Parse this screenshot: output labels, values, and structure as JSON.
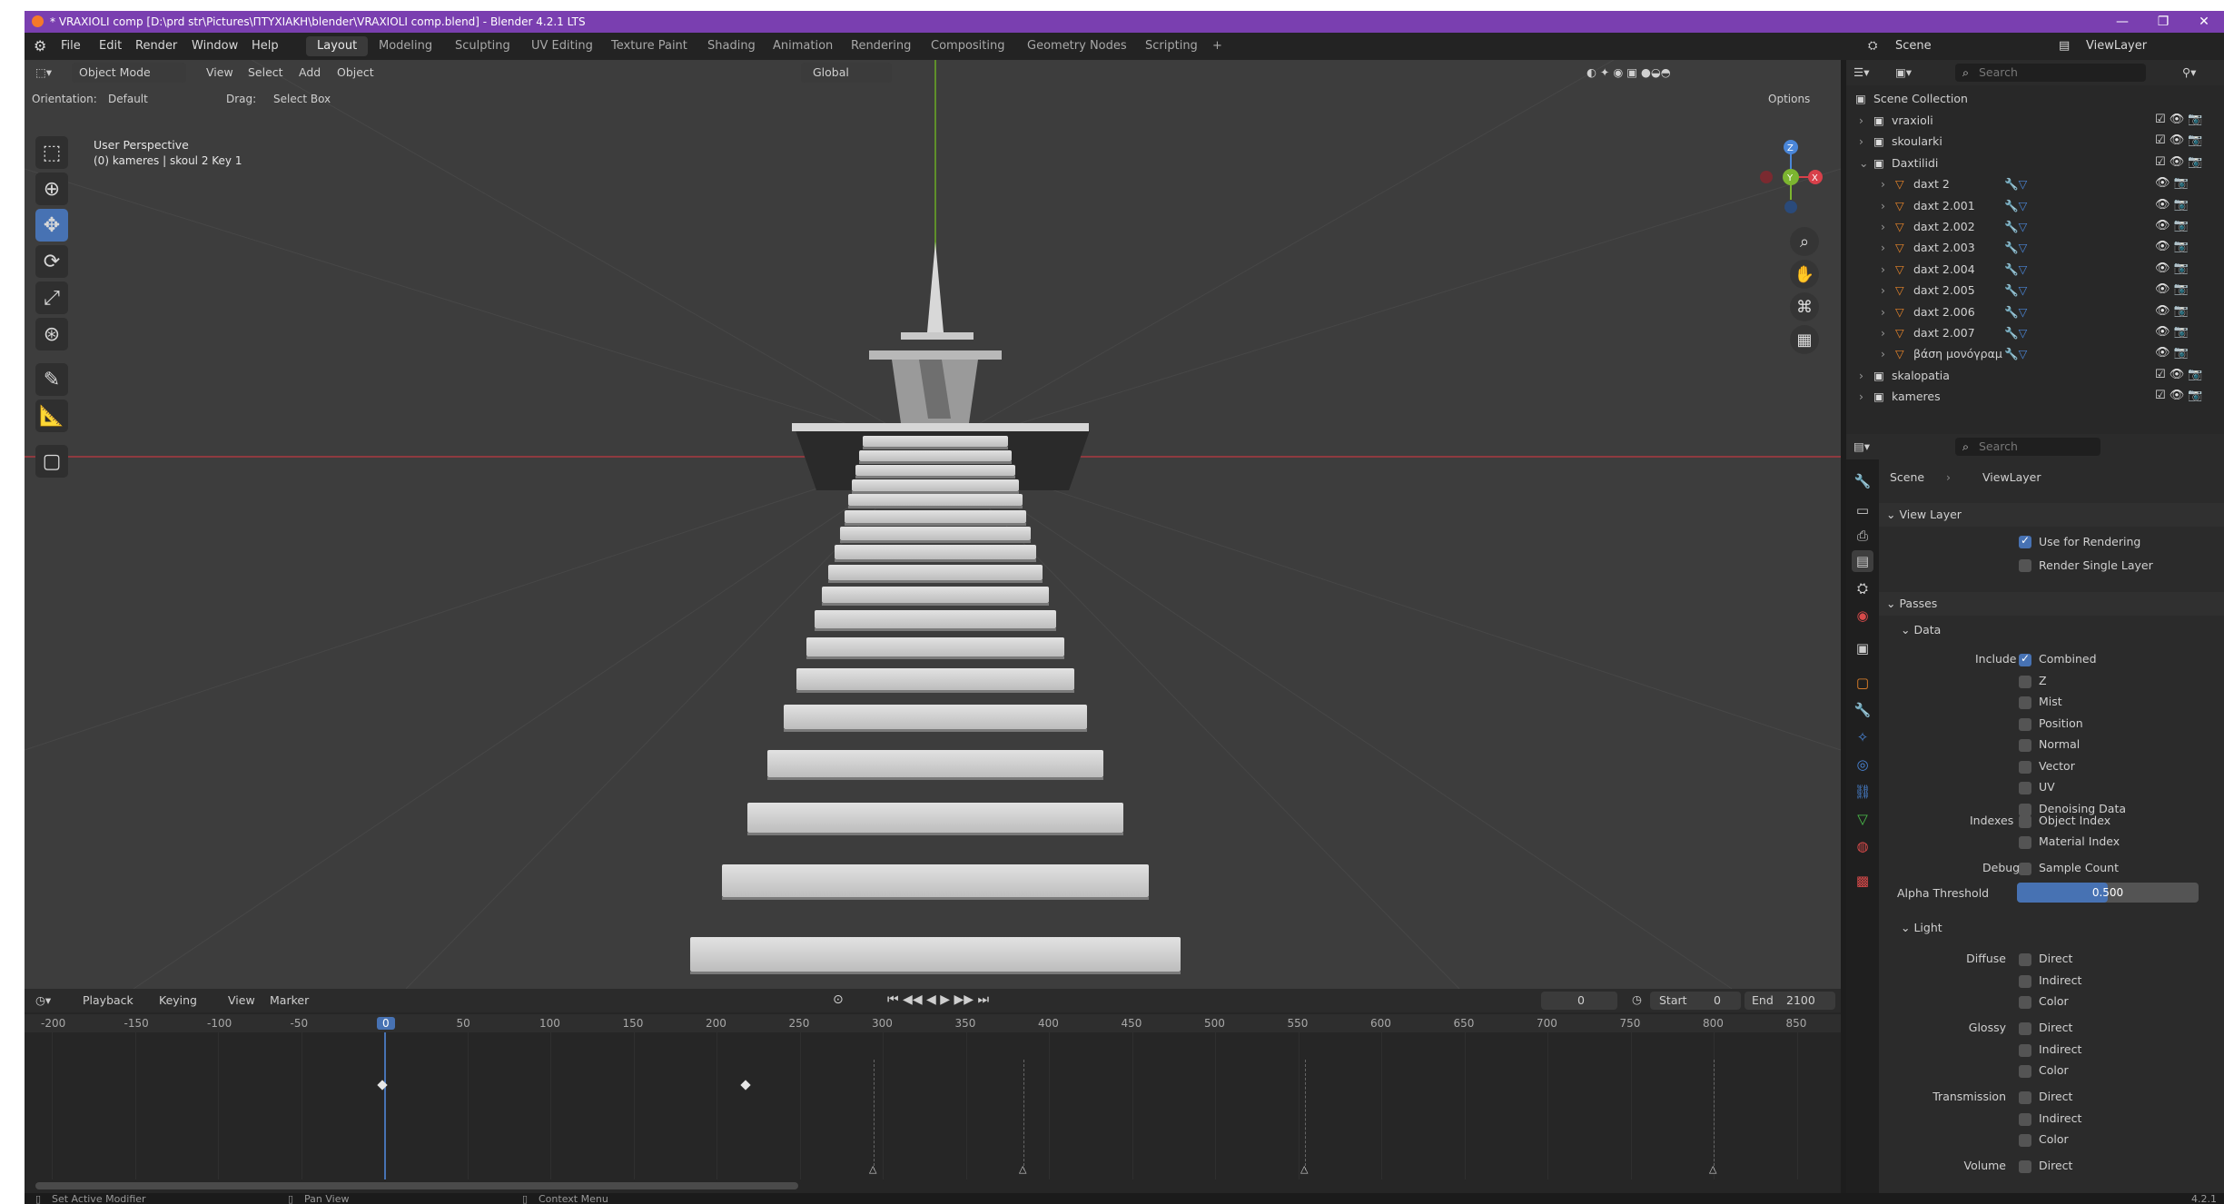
{
  "titlebar": {
    "title": "* VRAXIOLI comp [D:\\prd str\\Pictures\\ΠΤΥΧΙΑΚΗ\\blender\\VRAXIOLI comp.blend] - Blender 4.2.1 LTS",
    "minimize": "—",
    "maximize": "❐",
    "close": "✕"
  },
  "menubar": {
    "items": [
      "File",
      "Edit",
      "Render",
      "Window",
      "Help"
    ],
    "workspaces": [
      "Layout",
      "Modeling",
      "Sculpting",
      "UV Editing",
      "Texture Paint",
      "Shading",
      "Animation",
      "Rendering",
      "Compositing",
      "Geometry Nodes",
      "Scripting"
    ],
    "add_workspace": "+",
    "scene_label": "Scene",
    "viewlayer_label": "ViewLayer"
  },
  "viewport_header": {
    "mode": "Object Mode",
    "menus": [
      "View",
      "Select",
      "Add",
      "Object"
    ],
    "transform": "Global",
    "orientation_label": "Orientation:",
    "orientation_value": "Default",
    "drag_label": "Drag:",
    "drag_value": "Select Box",
    "options": "Options"
  },
  "viewport": {
    "perspective": "User Perspective",
    "info": "(0) kameres | skoul 2  Key 1",
    "nav_axes": [
      "Z",
      "Y",
      "X"
    ]
  },
  "timeline": {
    "menus": [
      "Playback",
      "Keying",
      "View",
      "Marker"
    ],
    "current_frame": "0",
    "start_label": "Start",
    "start_value": "0",
    "end_label": "End",
    "end_value": "2100",
    "ticks": [
      "-200",
      "-150",
      "-100",
      "-50",
      "0",
      "50",
      "100",
      "150",
      "200",
      "250",
      "300",
      "350",
      "400",
      "450",
      "500",
      "550",
      "600",
      "650",
      "700",
      "750",
      "800",
      "850"
    ]
  },
  "statusbar": {
    "items": [
      "Set Active Modifier",
      "Pan View",
      "Context Menu"
    ],
    "version": "4.2.1"
  },
  "outliner": {
    "search_placeholder": "Search",
    "root": "Scene Collection",
    "rows": [
      {
        "name": "vraxioli",
        "indent": 0
      },
      {
        "name": "skoularki",
        "indent": 0
      },
      {
        "name": "Daxtilidi",
        "indent": 0
      },
      {
        "name": "daxt 2",
        "indent": 1
      },
      {
        "name": "daxt 2.001",
        "indent": 1
      },
      {
        "name": "daxt 2.002",
        "indent": 1
      },
      {
        "name": "daxt 2.003",
        "indent": 1
      },
      {
        "name": "daxt 2.004",
        "indent": 1
      },
      {
        "name": "daxt 2.005",
        "indent": 1
      },
      {
        "name": "daxt 2.006",
        "indent": 1
      },
      {
        "name": "daxt 2.007",
        "indent": 1
      },
      {
        "name": "βάση μονόγραμ",
        "indent": 1
      },
      {
        "name": "skalopatia",
        "indent": 0
      },
      {
        "name": "kameres",
        "indent": 0
      }
    ]
  },
  "properties": {
    "search_placeholder": "Search",
    "breadcrumb_scene": "Scene",
    "breadcrumb_layer": "ViewLayer",
    "view_layer_section": "View Layer",
    "use_for_rendering": "Use for Rendering",
    "render_single_layer": "Render Single Layer",
    "passes_section": "Passes",
    "data_section": "Data",
    "include_label": "Include",
    "include_items": [
      "Combined",
      "Z",
      "Mist",
      "Position",
      "Normal",
      "Vector",
      "UV",
      "Denoising Data"
    ],
    "indexes_label": "Indexes",
    "indexes_items": [
      "Object Index",
      "Material Index"
    ],
    "debug_label": "Debug",
    "debug_item": "Sample Count",
    "alpha_label": "Alpha Threshold",
    "alpha_value": "0.500",
    "light_section": "Light",
    "diffuse_label": "Diffuse",
    "glossy_label": "Glossy",
    "transmission_label": "Transmission",
    "volume_label": "Volume",
    "light_items": [
      "Direct",
      "Indirect",
      "Color"
    ]
  },
  "colors": {
    "titlebar": "#7a3fb0",
    "accent": "#4772b3",
    "viewport_bg": "#3d3d3d",
    "x_axis": "#a0383f",
    "y_axis": "#6a9a2a"
  }
}
